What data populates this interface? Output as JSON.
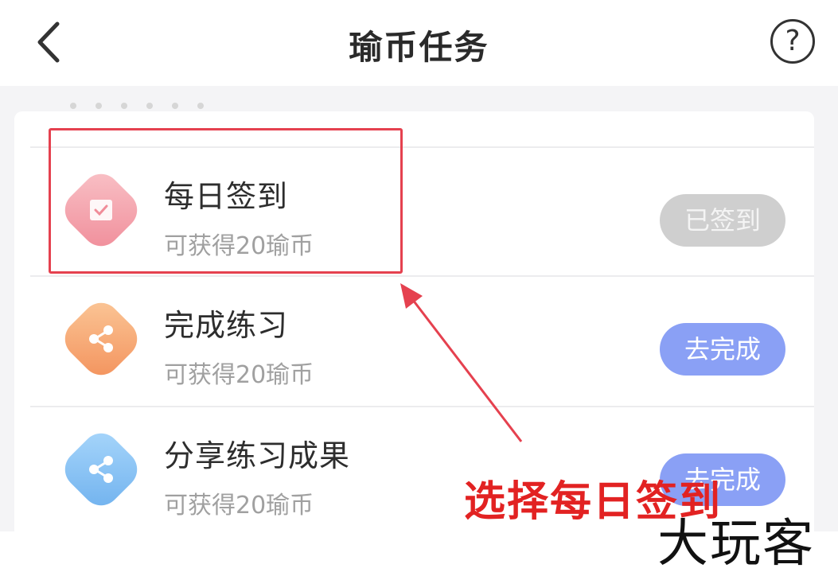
{
  "header": {
    "title": "瑜币任务",
    "back_icon": "chevron-left-icon",
    "help_icon": "question-circle-icon",
    "help_glyph": "?"
  },
  "tasks": [
    {
      "name": "每日签到",
      "reward": "可获得20瑜币",
      "button_label": "已签到",
      "state": "completed",
      "icon": "calendar-check-icon",
      "icon_color": "#f08c99"
    },
    {
      "name": "完成练习",
      "reward": "可获得20瑜币",
      "button_label": "去完成",
      "state": "pending",
      "icon": "share-icon",
      "icon_color": "#f3915b"
    },
    {
      "name": "分享练习成果",
      "reward": "可获得20瑜币",
      "button_label": "去完成",
      "state": "pending",
      "icon": "share-icon",
      "icon_color": "#6fb1ee"
    }
  ],
  "annotation": {
    "text": "选择每日签到",
    "color": "#e22222"
  },
  "watermark": "大玩客",
  "colors": {
    "primary_button": "#8aa0f5",
    "disabled_button": "#cfcfcf",
    "highlight": "#e5414f"
  }
}
